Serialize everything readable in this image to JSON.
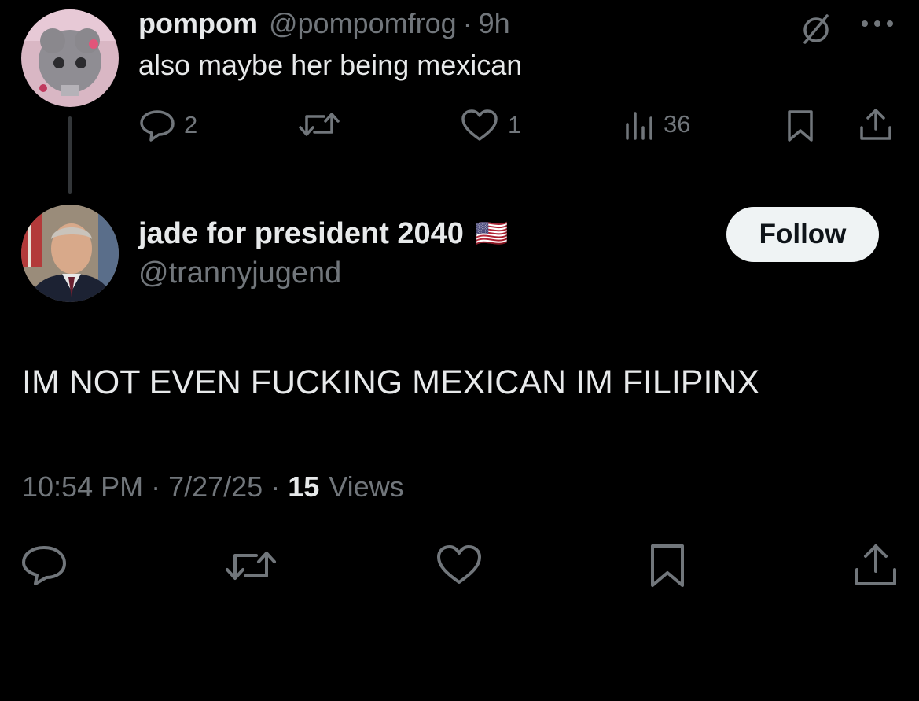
{
  "parent_tweet": {
    "display_name": "pompom",
    "handle": "@pompomfrog",
    "separator": "·",
    "time": "9h",
    "text": "also maybe her being mexican",
    "replies": "2",
    "likes": "1",
    "views": "36",
    "icons": [
      "no-entry-icon",
      "more-icon",
      "reply-icon",
      "retweet-icon",
      "like-icon",
      "views-icon",
      "bookmark-icon",
      "share-icon"
    ]
  },
  "main_tweet": {
    "display_name": "jade for president 2040",
    "flag": "🇺🇸",
    "handle": "@trannyjugend",
    "follow_label": "Follow",
    "text": "IM NOT EVEN FUCKING MEXICAN IM FILIPINX",
    "meta": {
      "time": "10:54 PM",
      "dot": "·",
      "date": "7/27/25",
      "views_count": "15",
      "views_label": "Views"
    },
    "icons": [
      "reply-icon",
      "retweet-icon",
      "like-icon",
      "bookmark-icon",
      "share-icon"
    ]
  },
  "colors": {
    "background": "#000000",
    "text": "#e7e9ea",
    "muted": "#71767b",
    "button_bg": "#eff3f4",
    "button_text": "#0f1419"
  }
}
